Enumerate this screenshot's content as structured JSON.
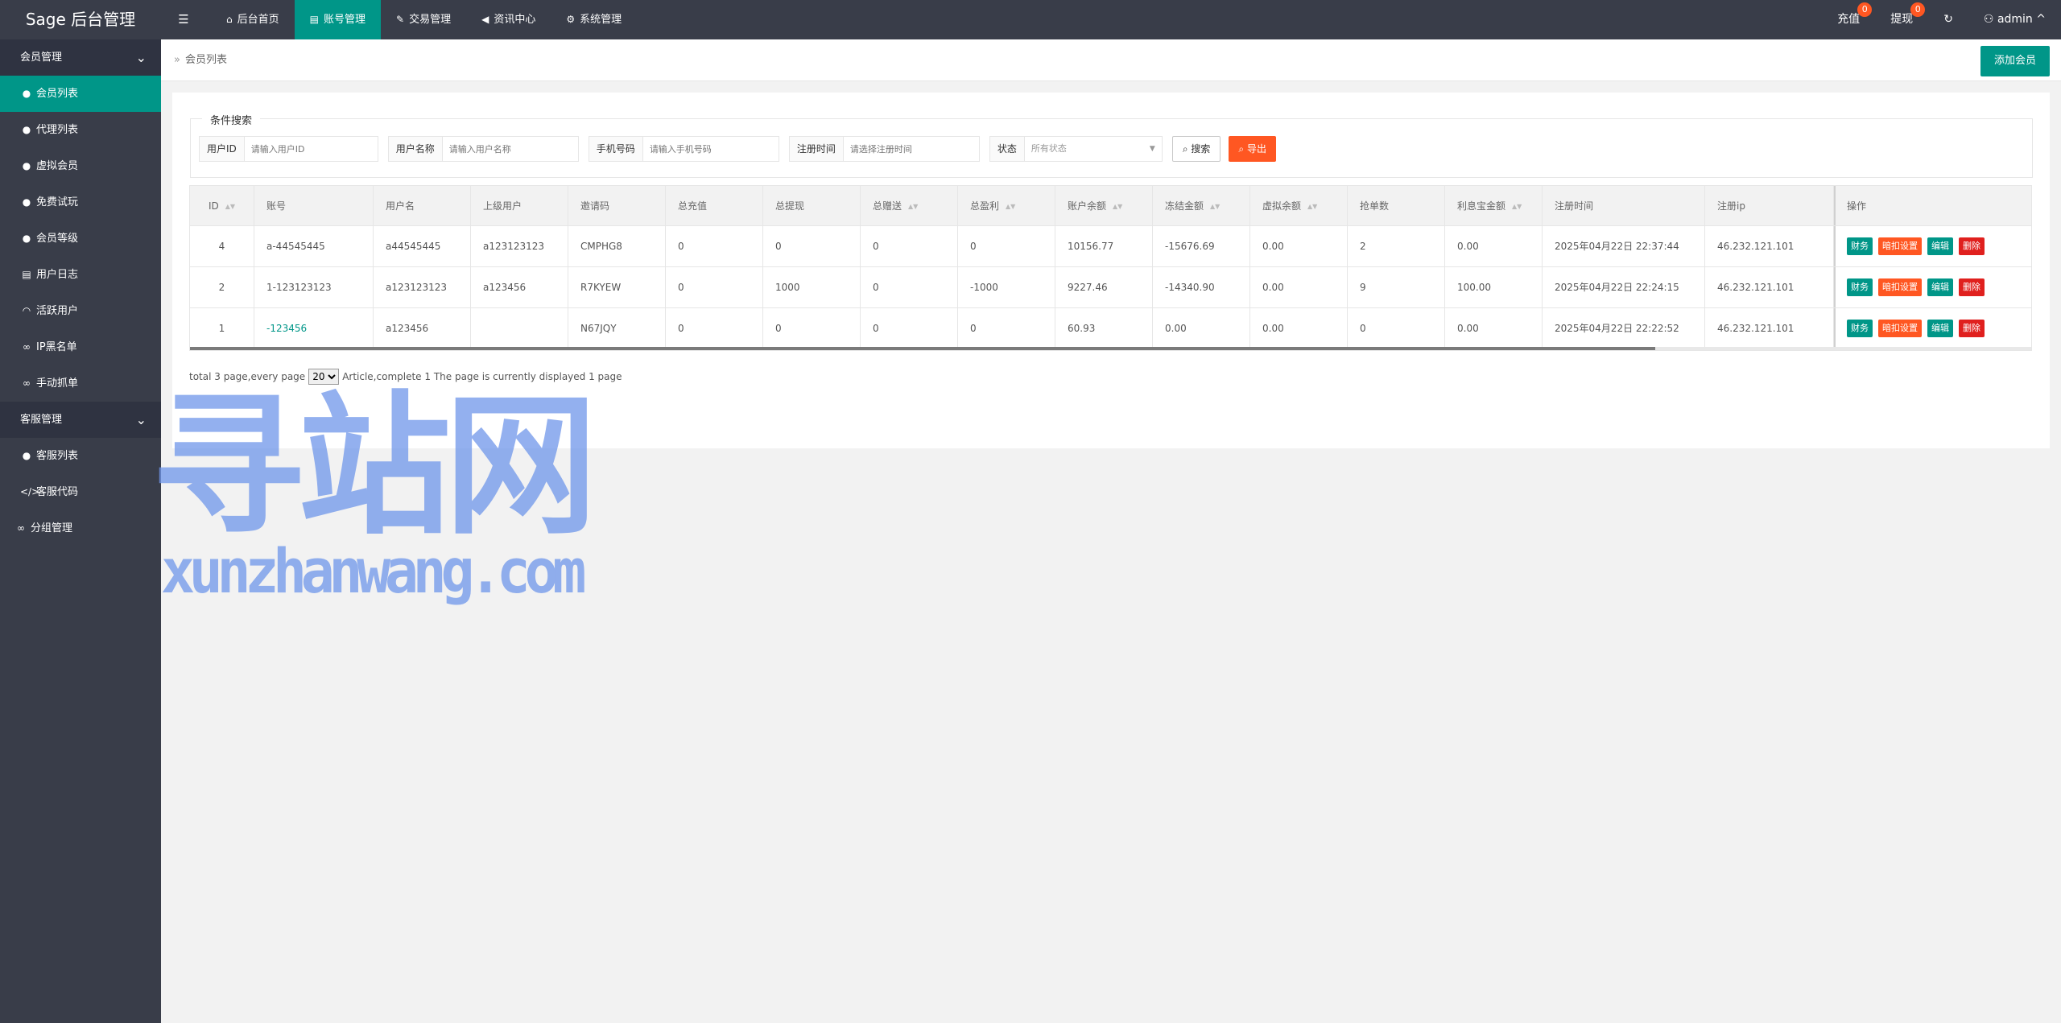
{
  "app": {
    "title": "Sage 后台管理",
    "menu_icon": "☰"
  },
  "topnav": [
    {
      "label": "后台首页",
      "icon": "⌂",
      "icon_name": "home-icon"
    },
    {
      "label": "账号管理",
      "icon": "▤",
      "icon_name": "id-card-icon",
      "active": true
    },
    {
      "label": "交易管理",
      "icon": "✎",
      "icon_name": "gavel-icon"
    },
    {
      "label": "资讯中心",
      "icon": "◀",
      "icon_name": "bullhorn-icon"
    },
    {
      "label": "系统管理",
      "icon": "⚙",
      "icon_name": "gears-icon"
    }
  ],
  "header_right": {
    "recharge_label": "充值",
    "recharge_badge": "0",
    "withdraw_label": "提现",
    "withdraw_badge": "0",
    "refresh_icon": "↻",
    "user_label": "admin",
    "user_icon": "⚇",
    "user_caret": "^"
  },
  "sidebar": {
    "group1": "会员管理",
    "items1": [
      {
        "label": "会员列表",
        "icon": "●",
        "icon_name": "user-icon",
        "active": true
      },
      {
        "label": "代理列表",
        "icon": "●",
        "icon_name": "users-icon"
      },
      {
        "label": "虚拟会员",
        "icon": "●",
        "icon_name": "user-secret-icon"
      },
      {
        "label": "免费试玩",
        "icon": "●",
        "icon_name": "user-md-icon"
      },
      {
        "label": "会员等级",
        "icon": "●",
        "icon_name": "users-level-icon"
      },
      {
        "label": "用户日志",
        "icon": "▤",
        "icon_name": "list-icon"
      },
      {
        "label": "活跃用户",
        "icon": "◠",
        "icon_name": "wifi-icon"
      },
      {
        "label": "IP黑名单",
        "icon": "∞",
        "icon_name": "link-icon"
      },
      {
        "label": "手动抓单",
        "icon": "∞",
        "icon_name": "link-icon"
      }
    ],
    "group2": "客服管理",
    "items2": [
      {
        "label": "客服列表",
        "icon": "●",
        "icon_name": "user-secret-icon"
      },
      {
        "label": "客服代码",
        "icon": "</>",
        "icon_name": "code-icon"
      }
    ],
    "item3": {
      "label": "分组管理",
      "icon": "∞",
      "icon_name": "link-icon"
    },
    "chevron": "⌄"
  },
  "breadcrumb": {
    "sep": "»",
    "current": "会员列表"
  },
  "add_button": "添加会员",
  "search": {
    "legend": "条件搜索",
    "userid_label": "用户ID",
    "userid_placeholder": "请输入用户ID",
    "username_label": "用户名称",
    "username_placeholder": "请输入用户名称",
    "phone_label": "手机号码",
    "phone_placeholder": "请输入手机号码",
    "regtime_label": "注册时间",
    "regtime_placeholder": "请选择注册时间",
    "status_label": "状态",
    "status_value": "所有状态",
    "search_button": "搜索",
    "search_icon": "⌕",
    "export_button": "导出",
    "export_icon": "⌕"
  },
  "table": {
    "columns": [
      "ID",
      "账号",
      "用户名",
      "上级用户",
      "邀请码",
      "总充值",
      "总提现",
      "总赠送",
      "总盈利",
      "账户余额",
      "冻结金额",
      "虚拟余额",
      "抢单数",
      "利息宝金额",
      "注册时间",
      "注册ip",
      "操作"
    ],
    "rows": [
      [
        "4",
        "a-44545445",
        "a44545445",
        "a123123123",
        "CMPHG8",
        "0",
        "0",
        "0",
        "0",
        "10156.77",
        "-15676.69",
        "0.00",
        "2",
        "0.00",
        "2025年04月22日 22:37:44",
        "46.232.121.101"
      ],
      [
        "2",
        "1-123123123",
        "a123123123",
        "a123456",
        "R7KYEW",
        "0",
        "1000",
        "0",
        "-1000",
        "9227.46",
        "-14340.90",
        "0.00",
        "9",
        "100.00",
        "2025年04月22日 22:24:15",
        "46.232.121.101"
      ],
      [
        "1",
        "-123456",
        "a123456",
        "",
        "N67JQY",
        "0",
        "0",
        "0",
        "0",
        "60.93",
        "0.00",
        "0.00",
        "0",
        "0.00",
        "2025年04月22日 22:22:52",
        "46.232.121.101"
      ]
    ],
    "actions": [
      "财务",
      "暗扣设置",
      "编辑",
      "删除"
    ],
    "sort_icon": "▲▼"
  },
  "pager": {
    "prefix": "total 3 page,every page",
    "page_size": "20",
    "suffix": "Article,complete 1 The page is currently displayed 1 page"
  },
  "watermark": {
    "line1": "寻站网",
    "line2": "xunzhanwang.com"
  }
}
